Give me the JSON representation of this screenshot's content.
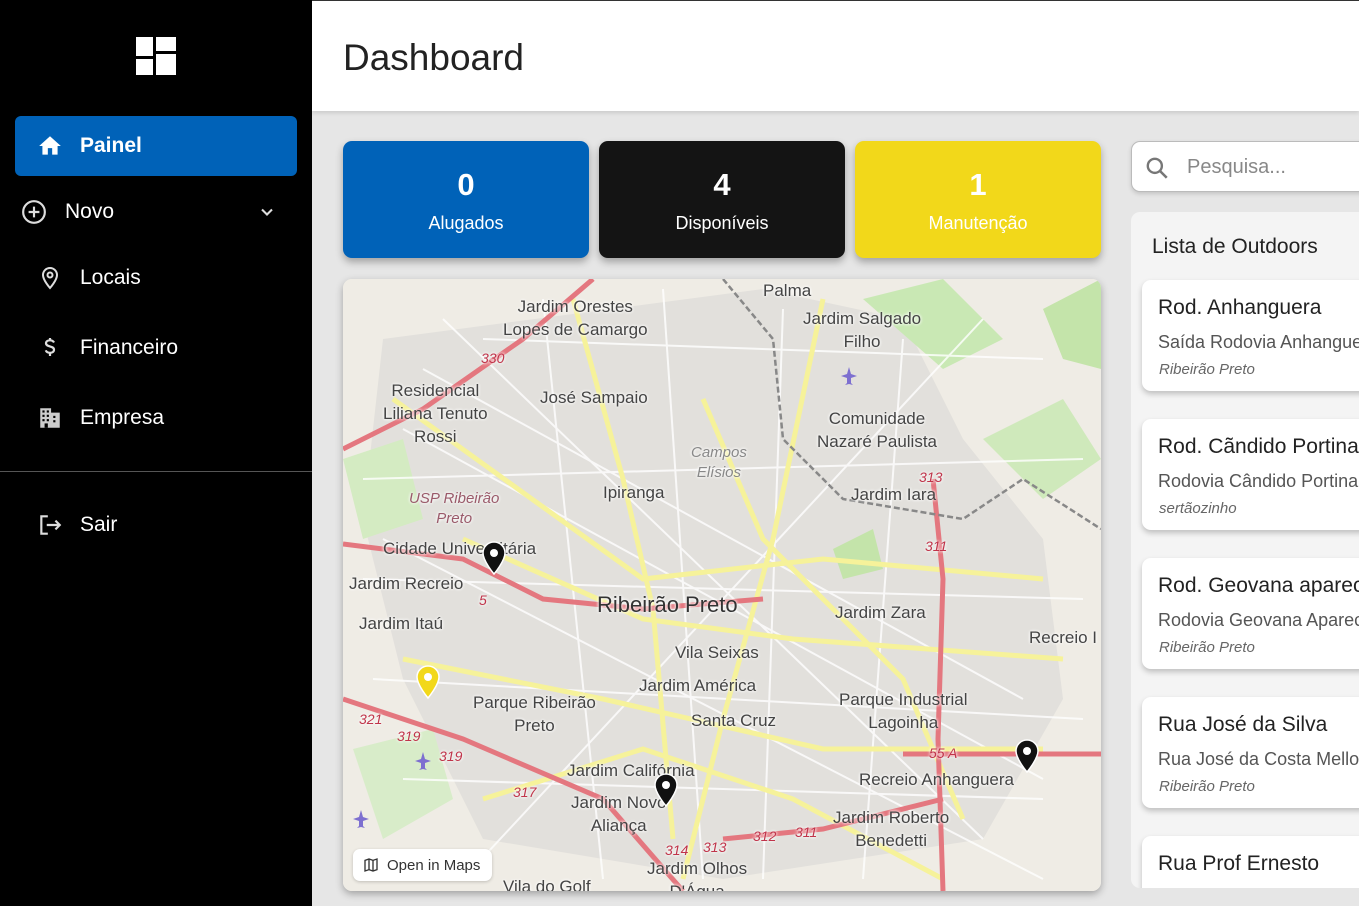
{
  "sidebar": {
    "items": [
      {
        "label": "Painel",
        "icon": "home-icon"
      },
      {
        "label": "Novo",
        "icon": "plus-circle-icon"
      },
      {
        "label": "Locais",
        "icon": "map-pin-icon"
      },
      {
        "label": "Financeiro",
        "icon": "dollar-icon"
      },
      {
        "label": "Empresa",
        "icon": "building-icon"
      },
      {
        "label": "Sair",
        "icon": "logout-icon"
      }
    ]
  },
  "header": {
    "title": "Dashboard"
  },
  "stats": [
    {
      "value": "0",
      "label": "Alugados",
      "color": "#0062b8"
    },
    {
      "value": "4",
      "label": "Disponíveis",
      "color": "#141414"
    },
    {
      "value": "1",
      "label": "Manutenção",
      "color": "#f2d81a"
    }
  ],
  "map": {
    "open_label": "Open in Maps",
    "city": "Ribeirão Preto",
    "labels": [
      "Palma",
      "Jardim Orestes Lopes de Camargo",
      "Jardim Salgado Filho",
      "Residencial Liliana Tenuto Rossi",
      "José Sampaio",
      "Comunidade Nazaré Paulista",
      "Campos Elísios",
      "Ipiranga",
      "Jardim Iara",
      "USP Ribeirão Preto",
      "Cidade Universitária",
      "Jardim Recreio",
      "Jardim Itaú",
      "Jardim Zara",
      "Recreio I",
      "Vila Seixas",
      "Jardim América",
      "Parque Ribeirão Preto",
      "Santa Cruz",
      "Parque Industrial Lagoinha",
      "Jardim Califórnia",
      "Recreio Anhanguera",
      "Jardim Novo Aliança",
      "Jardim Roberto Benedetti",
      "Jardim Olhos D'Água",
      "Vila do Golf"
    ],
    "road_labels": [
      "330",
      "313",
      "311",
      "5",
      "321",
      "319",
      "319",
      "317",
      "314",
      "313",
      "312",
      "311",
      "55 A"
    ],
    "pins": [
      {
        "color": "#111111",
        "status": "available"
      },
      {
        "color": "#f2d81a",
        "status": "maintenance"
      },
      {
        "color": "#111111",
        "status": "available"
      },
      {
        "color": "#111111",
        "status": "available"
      }
    ]
  },
  "search": {
    "placeholder": "Pesquisa...",
    "value": ""
  },
  "outdoor_list": {
    "title": "Lista de Outdoors",
    "items": [
      {
        "title": "Rod. Anhanguera",
        "address": "Saída Rodovia Anhanguera",
        "city": "Ribeirão Preto"
      },
      {
        "title": "Rod. Cãndido Portinari",
        "address": "Rodovia Cândido Portinari",
        "city": "sertãozinho"
      },
      {
        "title": "Rod. Geovana aparecida",
        "address": "Rodovia Geovana Aparecida",
        "city": "Ribeirão Preto"
      },
      {
        "title": "Rua José da Silva",
        "address": "Rua José da Costa Mello",
        "city": "Ribeirão Preto"
      },
      {
        "title": "Rua Prof Ernesto",
        "address": "",
        "city": ""
      }
    ]
  }
}
